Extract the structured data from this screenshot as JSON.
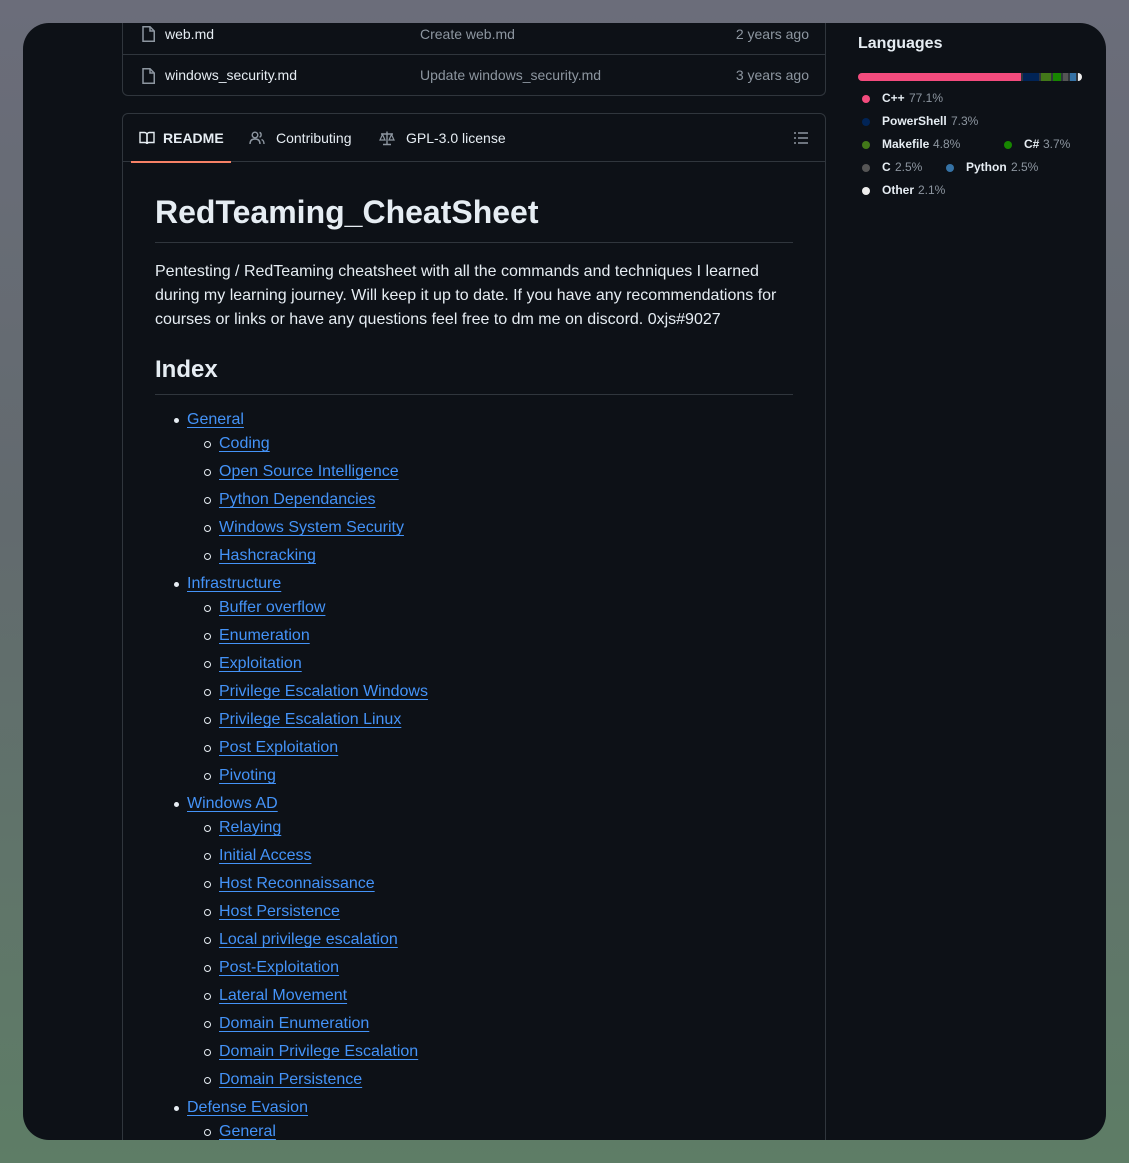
{
  "files": [
    {
      "name": "web.md",
      "message": "Create web.md",
      "age": "2 years ago"
    },
    {
      "name": "windows_security.md",
      "message": "Update windows_security.md",
      "age": "3 years ago"
    }
  ],
  "tabs": {
    "readme": "README",
    "contributing": "Contributing",
    "license": "GPL-3.0 license"
  },
  "readme": {
    "title": "RedTeaming_CheatSheet",
    "intro": "Pentesting / RedTeaming cheatsheet with all the commands and techniques I learned during my learning journey. Will keep it up to date. If you have any recommendations for courses or links or have any questions feel free to dm me on discord. 0xjs#9027",
    "index_heading": "Index",
    "index": [
      {
        "label": "General",
        "level": 1
      },
      {
        "label": "Coding",
        "level": 2
      },
      {
        "label": "Open Source Intelligence",
        "level": 2
      },
      {
        "label": "Python Dependancies",
        "level": 2
      },
      {
        "label": "Windows System Security",
        "level": 2
      },
      {
        "label": "Hashcracking",
        "level": 2
      },
      {
        "label": "Infrastructure",
        "level": 1
      },
      {
        "label": "Buffer overflow",
        "level": 2
      },
      {
        "label": "Enumeration",
        "level": 2
      },
      {
        "label": "Exploitation",
        "level": 2
      },
      {
        "label": "Privilege Escalation Windows",
        "level": 2
      },
      {
        "label": "Privilege Escalation Linux",
        "level": 2
      },
      {
        "label": "Post Exploitation",
        "level": 2
      },
      {
        "label": "Pivoting",
        "level": 2
      },
      {
        "label": "Windows AD",
        "level": 1
      },
      {
        "label": "Relaying",
        "level": 2
      },
      {
        "label": "Initial Access",
        "level": 2
      },
      {
        "label": "Host Reconnaissance",
        "level": 2
      },
      {
        "label": "Host Persistence",
        "level": 2
      },
      {
        "label": "Local privilege escalation",
        "level": 2
      },
      {
        "label": "Post-Exploitation",
        "level": 2
      },
      {
        "label": "Lateral Movement",
        "level": 2
      },
      {
        "label": "Domain Enumeration",
        "level": 2
      },
      {
        "label": "Domain Privilege Escalation",
        "level": 2
      },
      {
        "label": "Domain Persistence",
        "level": 2
      },
      {
        "label": "Defense Evasion",
        "level": 1
      },
      {
        "label": "General",
        "level": 2
      }
    ]
  },
  "sidebar": {
    "languages_title": "Languages",
    "languages": [
      {
        "name": "C++",
        "percent": "77.1%",
        "value": 77.1,
        "color": "#f34b7d"
      },
      {
        "name": "PowerShell",
        "percent": "7.3%",
        "value": 7.3,
        "color": "#012456"
      },
      {
        "name": "Makefile",
        "percent": "4.8%",
        "value": 4.8,
        "color": "#427819"
      },
      {
        "name": "C#",
        "percent": "3.7%",
        "value": 3.7,
        "color": "#178600"
      },
      {
        "name": "C",
        "percent": "2.5%",
        "value": 2.5,
        "color": "#555555"
      },
      {
        "name": "Python",
        "percent": "2.5%",
        "value": 2.5,
        "color": "#3572A5"
      },
      {
        "name": "Other",
        "percent": "2.1%",
        "value": 2.1,
        "color": "#ededed"
      }
    ]
  },
  "colors": {
    "background": "#0d1117",
    "link": "#4493f8",
    "tab_underline": "#f78166",
    "border": "#30363d"
  }
}
